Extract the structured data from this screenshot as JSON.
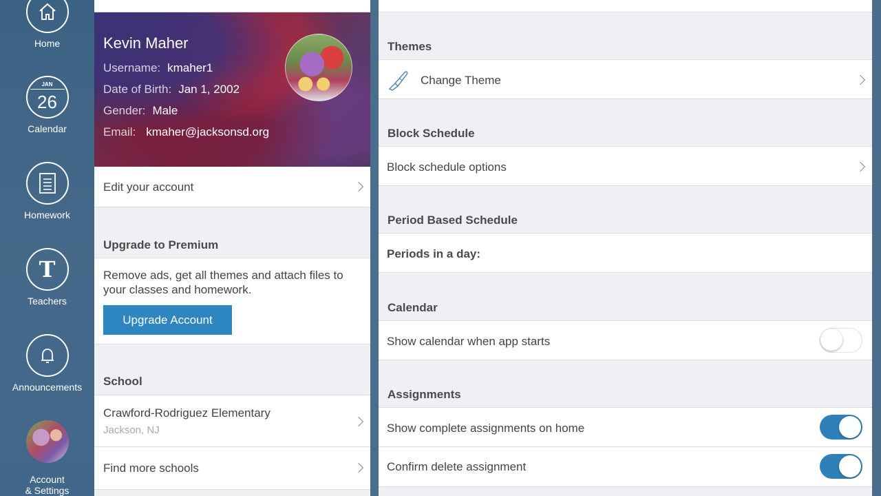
{
  "sidebar": {
    "items": [
      {
        "label": "Home",
        "icon": "home-icon"
      },
      {
        "label": "Calendar",
        "icon": "calendar-icon",
        "month": "JAN",
        "day": "26"
      },
      {
        "label": "Homework",
        "icon": "homework-icon"
      },
      {
        "label": "Teachers",
        "icon": "teachers-icon",
        "glyph": "T"
      },
      {
        "label": "Announcements",
        "icon": "bell-icon"
      },
      {
        "label": "Account\n& Settings",
        "icon": "avatar"
      }
    ]
  },
  "profile": {
    "name": "Kevin Maher",
    "username_label": "Username:",
    "username": "kmaher1",
    "dob_label": "Date of Birth:",
    "dob": "Jan 1, 2002",
    "gender_label": "Gender:",
    "gender": "Male",
    "email_label": "Email:",
    "email": "kmaher@jacksonsd.org"
  },
  "left": {
    "edit_account": "Edit your account",
    "premium_header": "Upgrade to Premium",
    "premium_text": "Remove ads, get all themes and attach files to your classes and homework.",
    "upgrade_button": "Upgrade Account",
    "school_header": "School",
    "school_name": "Crawford-Rodriguez Elementary",
    "school_location": "Jackson, NJ",
    "find_schools": "Find more schools"
  },
  "right": {
    "themes_header": "Themes",
    "change_theme": "Change Theme",
    "block_header": "Block Schedule",
    "block_options": "Block schedule options",
    "period_header": "Period Based Schedule",
    "periods_label": "Periods in a day:",
    "calendar_header": "Calendar",
    "show_calendar": "Show calendar when app starts",
    "show_calendar_on": false,
    "assignments_header": "Assignments",
    "show_complete": "Show complete assignments on home",
    "show_complete_on": true,
    "confirm_delete": "Confirm delete assignment",
    "confirm_delete_on": true
  },
  "colors": {
    "accent": "#2e86c1",
    "sidebar": "#3f6685",
    "toggle_on": "#2f80b8"
  }
}
